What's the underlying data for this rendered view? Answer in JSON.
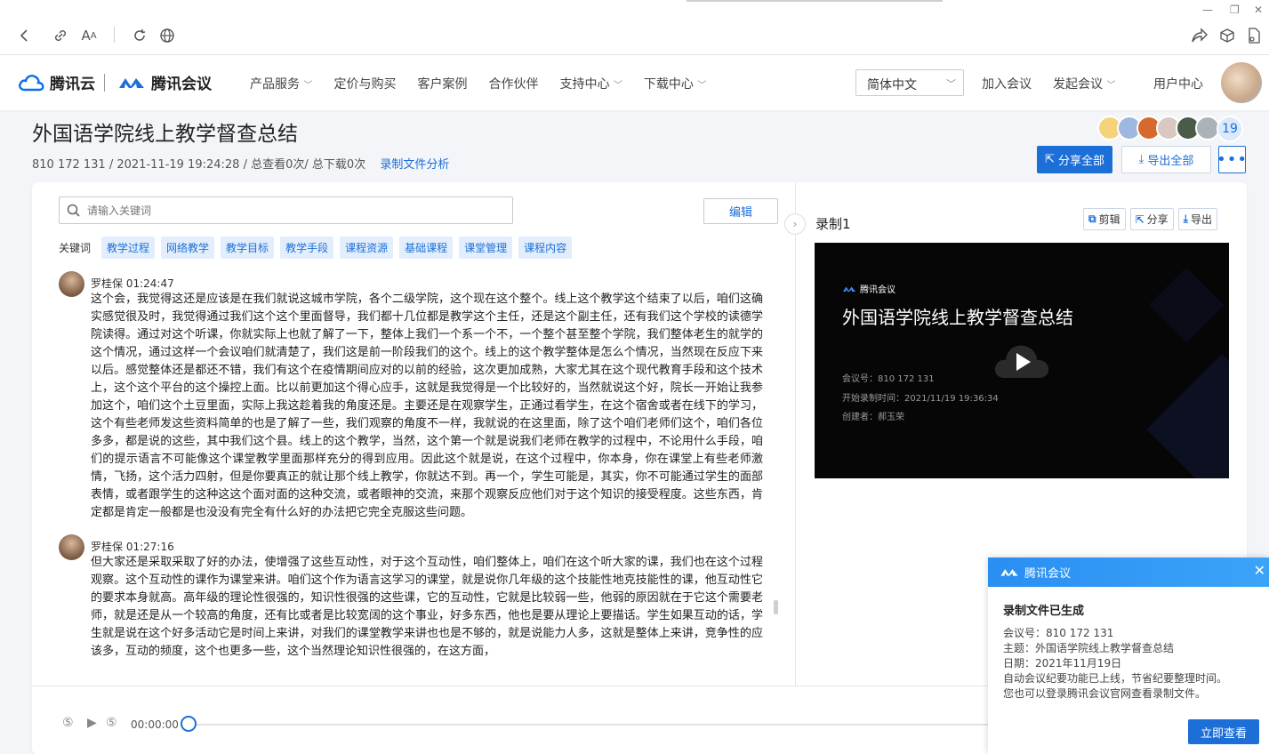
{
  "browser": {
    "window_controls": [
      "—",
      "❐",
      "✕"
    ]
  },
  "header": {
    "logo_cloud": "腾讯云",
    "logo_meeting": "腾讯会议",
    "nav": [
      {
        "label": "产品服务",
        "has_menu": true
      },
      {
        "label": "定价与购买",
        "has_menu": false
      },
      {
        "label": "客户案例",
        "has_menu": false
      },
      {
        "label": "合作伙伴",
        "has_menu": false
      },
      {
        "label": "支持中心",
        "has_menu": true
      },
      {
        "label": "下载中心",
        "has_menu": true
      }
    ],
    "language": "简体中文",
    "join_meeting": "加入会议",
    "start_meeting": "发起会议",
    "user_center": "用户中心"
  },
  "meeting": {
    "title": "外国语学院线上教学督查总结",
    "meeting_id": "810 172 131",
    "datetime": "/ 2021-11-19 19:24:28",
    "stats": "/ 总查看0次/ 总下载0次",
    "analysis_link": "录制文件分析",
    "participant_count": "19",
    "share_all": "分享全部",
    "export_all": "导出全部",
    "more": "•••"
  },
  "search": {
    "placeholder": "请输入关键词",
    "edit": "编辑"
  },
  "keywords": {
    "label": "关键词",
    "tags": [
      "教学过程",
      "网络教学",
      "教学目标",
      "教学手段",
      "课程资源",
      "基础课程",
      "课堂管理",
      "课程内容"
    ]
  },
  "transcript": [
    {
      "speaker": "罗桂保 01:24:47",
      "text": "这个会，我觉得这还是应该是在我们就说这城市学院，各个二级学院，这个现在这个整个。线上这个教学这个结束了以后，咱们这确实感觉很及时，我觉得通过我们这个这个里面督导，我们都十几位都是教学这个主任，还是这个副主任，还有我们这个学校的读德学院读得。通过对这个听课，你就实际上也就了解了一下，整体上我们一个系一个不，一个整个甚至整个学院，我们整体老生的就学的这个情况，通过这样一个会议咱们就清楚了，我们这是前一阶段我们的这个。线上的这个教学整体是怎么个情况，当然现在反应下来以后。感觉整体还是都还不错，我们有这个在疫情期间应对的以前的经验，这次更加成熟，大家尤其在这个现代教育手段和这个技术上，这个这个平台的这个操控上面。比以前更加这个得心应手，这就是我觉得是一个比较好的，当然就说这个好，院长一开始让我参加这个，咱们这个土豆里面，实际上我这趁着我的角度还是。主要还是在观察学生，正通过看学生，在这个宿舍或者在线下的学习，这个有些老师发这些资料简单的也是了解了一些，我们观察的角度不一样，我就说的在这里面，除了这个咱们老师们这个，咱们各位多多，都是说的这些，其中我们这个县。线上的这个教学，当然，这个第一个就是说我们老师在教学的过程中，不论用什么手段，咱们的提示语言不可能像这个课堂教学里面那样充分的得到应用。因此这个就是说，在这个过程中，你本身，你在课堂上有些老师激情，飞扬，这个活力四射，但是你要真正的就让那个线上教学，你就达不到。再一个，学生可能是，其实，你不可能通过学生的面部表情，或者跟学生的这种这这个面对面的这种交流，或者眼神的交流，来那个观察反应他们对于这个知识的接受程度。这些东西，肯定都是肯定一般都是也没没有完全有什么好的办法把它完全克服这些问题。"
    },
    {
      "speaker": "罗桂保 01:27:16",
      "text": "但大家还是采取采取了好的办法，使增强了这些互动性，对于这个互动性，咱们整体上，咱们在这个听大家的课，我们也在这个过程观察。这个互动性的课作为课堂来讲。咱们这个作为语言这学习的课堂，就是说你几年级的这个技能性地克技能性的课，他互动性它的要求本身就高。高年级的理论性很强的，知识性很强的这些课，它的互动性，它就是比较弱一些，他弱的原因就在于它这个需要老师，就是还是从一个较高的角度，还有比或者是比较宽阔的这个事业，好多东西，他也是要从理论上要描话。学生如果互动的话，学生就是说在这个好多活动它是时间上来讲，对我们的课堂教学来讲也也是不够的，就是说能力人多，这就是整体上来讲，竞争性的应该多，互动的频度，这个也更多一些，这个当然理论知识性很强的，在这方面，"
    }
  ],
  "player": {
    "time": "00:00:00",
    "progress": 0
  },
  "recording": {
    "title": "录制1",
    "actions": [
      "剪辑",
      "分享",
      "导出"
    ],
    "video": {
      "brand": "腾讯会议",
      "title": "外国语学院线上教学督查总结",
      "meeting_id": "会议号：810 172 131",
      "start_time": "开始录制时间：2021/11/19 19:36:34",
      "creator": "创建者：郝玉荣"
    }
  },
  "notification": {
    "app": "腾讯会议",
    "title": "录制文件已生成",
    "lines": [
      "会议号：810 172 131",
      "主题：外国语学院线上教学督查总结",
      "日期：2021年11月19日",
      "自动会议纪要功能已上线，节省纪要整理时间。",
      "您也可以登录腾讯会议官网查看录制文件。"
    ],
    "button": "立即查看"
  },
  "colors": {
    "accent": "#1d6fd8",
    "tag_bg": "#e3eefc",
    "video_bg": "#060606"
  }
}
